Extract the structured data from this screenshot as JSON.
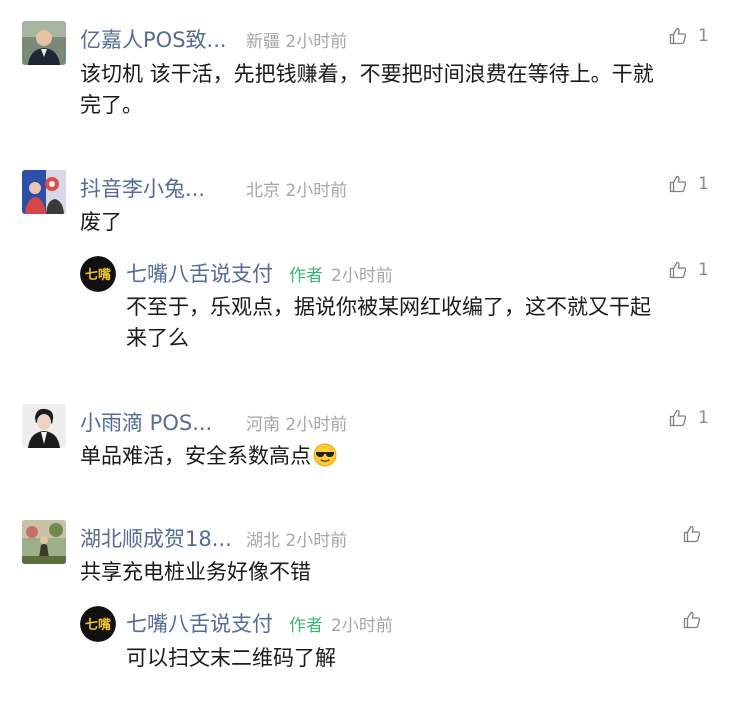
{
  "comments": [
    {
      "nickname": "亿嘉人POS致...",
      "location": "新疆",
      "time": "2小时前",
      "likes": "1",
      "content_line1": "该切机 该干活，先把钱赚着，不要把时间浪费在等待上。干就",
      "content_line2": "完了。",
      "avatar_colors": {
        "bg": "#7a8a78",
        "suit": "#1e2633",
        "skin": "#e4c2a4"
      }
    },
    {
      "nickname": "抖音李小兔...",
      "location": "北京",
      "time": "2小时前",
      "likes": "1",
      "content": "废了",
      "avatar_colors": {
        "bg": "#2c4fa8",
        "accent": "#e04a4a"
      },
      "reply": {
        "nickname": "七嘴八舌说支付",
        "author_tag": "作者",
        "time": "2小时前",
        "likes": "1",
        "content_line1": "不至于，乐观点，据说你被某网红收编了，这不就又干起",
        "content_line2": "来了么",
        "logo_text": "七嘴"
      }
    },
    {
      "nickname": "小雨滴 POS...",
      "location": "河南",
      "time": "2小时前",
      "likes": "1",
      "content": "单品难活，安全系数高点",
      "emoji": "cool-sunglasses-emoji",
      "avatar_colors": {
        "bg": "#eeeeee",
        "coat": "#1c1c1c",
        "skin": "#ecd3c1"
      }
    },
    {
      "nickname": "湖北顺成贺18...",
      "location": "湖北",
      "time": "2小时前",
      "likes": "",
      "content": "共享充电桩业务好像不错",
      "avatar_colors": {
        "bg": "#9bb08a",
        "figure": "#3a3a2a"
      },
      "reply": {
        "nickname": "七嘴八舌说支付",
        "author_tag": "作者",
        "time": "2小时前",
        "likes": "",
        "content": "可以扫文末二维码了解",
        "logo_text": "七嘴"
      }
    }
  ],
  "icons": {
    "like": "thumbs-up-icon"
  },
  "colors": {
    "nickname": "#576b95",
    "meta": "#a6a6a6",
    "author": "#3eb575",
    "text": "#1a1a1a"
  }
}
